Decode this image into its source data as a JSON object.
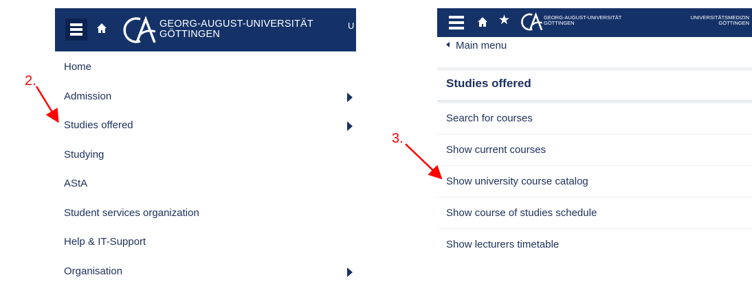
{
  "left": {
    "header": {
      "uni_line1": "GEORG-AUGUST-UNIVERSITÄT",
      "uni_line2": "GÖTTINGEN",
      "cut_text": "U"
    },
    "menu": [
      {
        "label": "Home",
        "has_submenu": false
      },
      {
        "label": "Admission",
        "has_submenu": true
      },
      {
        "label": "Studies offered",
        "has_submenu": true
      },
      {
        "label": "Studying",
        "has_submenu": false
      },
      {
        "label": "AStA",
        "has_submenu": false
      },
      {
        "label": "Student services organization",
        "has_submenu": false
      },
      {
        "label": "Help & IT-Support",
        "has_submenu": false
      },
      {
        "label": "Organisation",
        "has_submenu": true
      }
    ]
  },
  "right": {
    "header": {
      "uni_line1": "GEORG-AUGUST-UNIVERSITÄT",
      "uni_line2": "GÖTTINGEN",
      "med_line1": "UNIVERSITÄTSMEDIZIN",
      "med_line2": "GÖTTINGEN"
    },
    "back_label": "Main menu",
    "section_title": "Studies offered",
    "menu": [
      "Search for courses",
      "Show current courses",
      "Show university course catalog",
      "Show course of studies schedule",
      "Show lecturers timetable"
    ]
  },
  "annotations": {
    "step2": "2.",
    "step3": "3."
  },
  "colors": {
    "header_bg": "#153268",
    "text": "#1c2f5c",
    "annotation": "#ff0000"
  },
  "icons": [
    "menu-icon",
    "home-icon",
    "star-icon",
    "university-logo-icon",
    "chevron-right-icon",
    "chevron-left-icon"
  ]
}
